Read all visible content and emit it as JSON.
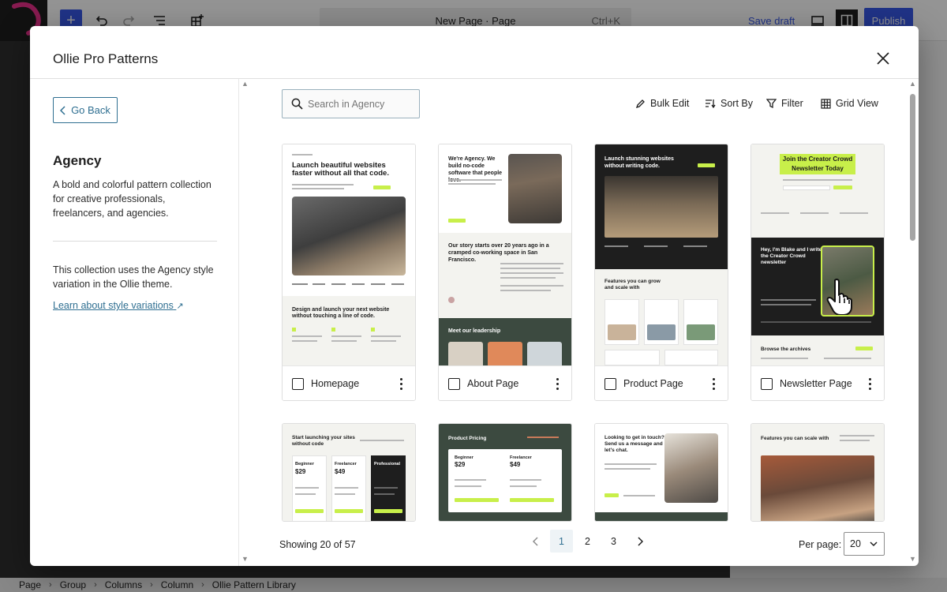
{
  "editor": {
    "page_title": "New Page · Page",
    "shortcut": "Ctrl+K",
    "save_draft": "Save draft",
    "publish": "Publish"
  },
  "breadcrumbs": [
    "Page",
    "Group",
    "Columns",
    "Column",
    "Ollie Pattern Library"
  ],
  "modal": {
    "title": "Ollie Pro Patterns",
    "go_back": "Go Back",
    "collection": {
      "title": "Agency",
      "description": "A bold and colorful pattern collection for creative professionals, freelancers, and agencies.",
      "note": "This collection uses the Agency style variation in the Ollie theme.",
      "learn_link": "Learn about style variations",
      "learn_link_icon": "↗"
    },
    "search": {
      "placeholder": "Search in Agency",
      "value": ""
    },
    "toolbar": {
      "bulk_edit": "Bulk Edit",
      "sort_by": "Sort By",
      "filter": "Filter",
      "grid_view": "Grid View"
    },
    "patterns": [
      {
        "label": "Homepage"
      },
      {
        "label": "About Page"
      },
      {
        "label": "Product Page"
      },
      {
        "label": "Newsletter Page"
      }
    ],
    "thumb_text": {
      "home_heading": "Launch beautiful websites faster without all that code.",
      "home_sub": "Design and launch your next website without touching a line of code.",
      "about_heading": "We're Agency. We build no-code software that people love.",
      "about_story": "Our story starts over 20 years ago in a cramped co-working space in San Francisco.",
      "about_leadership": "Meet our leadership",
      "product_heading": "Launch stunning websites without writing code.",
      "product_features": "Features you can grow and scale with",
      "news_heading": "Join the Creator Crowd Newsletter Today",
      "news_intro": "Hey, I'm Blake and I write the Creator Crowd newsletter",
      "news_archive": "Browse the archives",
      "pricing_a_heading": "Start launching your sites without code",
      "pricing_b_heading": "Product Pricing",
      "contact_heading": "Looking to get in touch? Send us a message and let's chat.",
      "features_heading": "Features you can scale with",
      "tier_1": "Beginner",
      "tier_2": "Freelancer",
      "tier_3": "Professional",
      "price_1": "$29",
      "price_2": "$49"
    },
    "pagination": {
      "showing": "Showing 20 of 57",
      "pages": [
        "1",
        "2",
        "3"
      ],
      "current": "1",
      "per_page_label": "Per page:",
      "per_page_value": "20"
    }
  },
  "colors": {
    "accent": "#2f6f91",
    "wp_blue": "#3858e9",
    "lime": "#c8ef4a",
    "dark_green": "#3c4a40"
  }
}
